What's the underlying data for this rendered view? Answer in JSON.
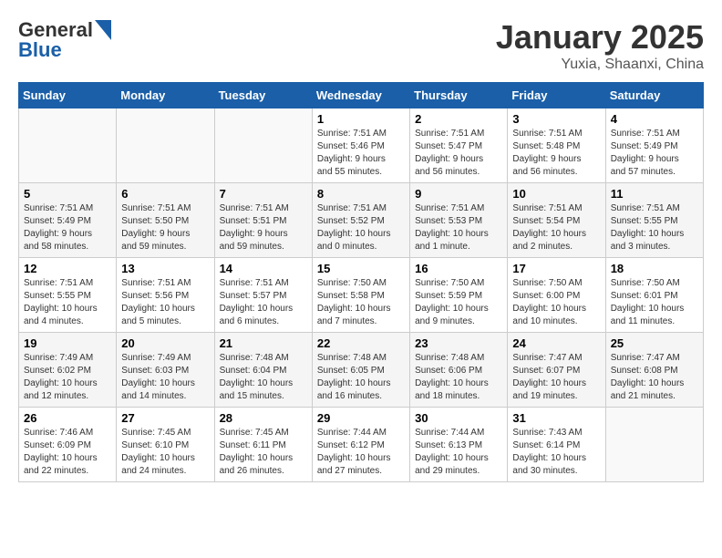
{
  "header": {
    "logo_line1": "General",
    "logo_line2": "Blue",
    "month": "January 2025",
    "location": "Yuxia, Shaanxi, China"
  },
  "weekdays": [
    "Sunday",
    "Monday",
    "Tuesday",
    "Wednesday",
    "Thursday",
    "Friday",
    "Saturday"
  ],
  "weeks": [
    [
      {
        "day": "",
        "info": ""
      },
      {
        "day": "",
        "info": ""
      },
      {
        "day": "",
        "info": ""
      },
      {
        "day": "1",
        "info": "Sunrise: 7:51 AM\nSunset: 5:46 PM\nDaylight: 9 hours\nand 55 minutes."
      },
      {
        "day": "2",
        "info": "Sunrise: 7:51 AM\nSunset: 5:47 PM\nDaylight: 9 hours\nand 56 minutes."
      },
      {
        "day": "3",
        "info": "Sunrise: 7:51 AM\nSunset: 5:48 PM\nDaylight: 9 hours\nand 56 minutes."
      },
      {
        "day": "4",
        "info": "Sunrise: 7:51 AM\nSunset: 5:49 PM\nDaylight: 9 hours\nand 57 minutes."
      }
    ],
    [
      {
        "day": "5",
        "info": "Sunrise: 7:51 AM\nSunset: 5:49 PM\nDaylight: 9 hours\nand 58 minutes."
      },
      {
        "day": "6",
        "info": "Sunrise: 7:51 AM\nSunset: 5:50 PM\nDaylight: 9 hours\nand 59 minutes."
      },
      {
        "day": "7",
        "info": "Sunrise: 7:51 AM\nSunset: 5:51 PM\nDaylight: 9 hours\nand 59 minutes."
      },
      {
        "day": "8",
        "info": "Sunrise: 7:51 AM\nSunset: 5:52 PM\nDaylight: 10 hours\nand 0 minutes."
      },
      {
        "day": "9",
        "info": "Sunrise: 7:51 AM\nSunset: 5:53 PM\nDaylight: 10 hours\nand 1 minute."
      },
      {
        "day": "10",
        "info": "Sunrise: 7:51 AM\nSunset: 5:54 PM\nDaylight: 10 hours\nand 2 minutes."
      },
      {
        "day": "11",
        "info": "Sunrise: 7:51 AM\nSunset: 5:55 PM\nDaylight: 10 hours\nand 3 minutes."
      }
    ],
    [
      {
        "day": "12",
        "info": "Sunrise: 7:51 AM\nSunset: 5:55 PM\nDaylight: 10 hours\nand 4 minutes."
      },
      {
        "day": "13",
        "info": "Sunrise: 7:51 AM\nSunset: 5:56 PM\nDaylight: 10 hours\nand 5 minutes."
      },
      {
        "day": "14",
        "info": "Sunrise: 7:51 AM\nSunset: 5:57 PM\nDaylight: 10 hours\nand 6 minutes."
      },
      {
        "day": "15",
        "info": "Sunrise: 7:50 AM\nSunset: 5:58 PM\nDaylight: 10 hours\nand 7 minutes."
      },
      {
        "day": "16",
        "info": "Sunrise: 7:50 AM\nSunset: 5:59 PM\nDaylight: 10 hours\nand 9 minutes."
      },
      {
        "day": "17",
        "info": "Sunrise: 7:50 AM\nSunset: 6:00 PM\nDaylight: 10 hours\nand 10 minutes."
      },
      {
        "day": "18",
        "info": "Sunrise: 7:50 AM\nSunset: 6:01 PM\nDaylight: 10 hours\nand 11 minutes."
      }
    ],
    [
      {
        "day": "19",
        "info": "Sunrise: 7:49 AM\nSunset: 6:02 PM\nDaylight: 10 hours\nand 12 minutes."
      },
      {
        "day": "20",
        "info": "Sunrise: 7:49 AM\nSunset: 6:03 PM\nDaylight: 10 hours\nand 14 minutes."
      },
      {
        "day": "21",
        "info": "Sunrise: 7:48 AM\nSunset: 6:04 PM\nDaylight: 10 hours\nand 15 minutes."
      },
      {
        "day": "22",
        "info": "Sunrise: 7:48 AM\nSunset: 6:05 PM\nDaylight: 10 hours\nand 16 minutes."
      },
      {
        "day": "23",
        "info": "Sunrise: 7:48 AM\nSunset: 6:06 PM\nDaylight: 10 hours\nand 18 minutes."
      },
      {
        "day": "24",
        "info": "Sunrise: 7:47 AM\nSunset: 6:07 PM\nDaylight: 10 hours\nand 19 minutes."
      },
      {
        "day": "25",
        "info": "Sunrise: 7:47 AM\nSunset: 6:08 PM\nDaylight: 10 hours\nand 21 minutes."
      }
    ],
    [
      {
        "day": "26",
        "info": "Sunrise: 7:46 AM\nSunset: 6:09 PM\nDaylight: 10 hours\nand 22 minutes."
      },
      {
        "day": "27",
        "info": "Sunrise: 7:45 AM\nSunset: 6:10 PM\nDaylight: 10 hours\nand 24 minutes."
      },
      {
        "day": "28",
        "info": "Sunrise: 7:45 AM\nSunset: 6:11 PM\nDaylight: 10 hours\nand 26 minutes."
      },
      {
        "day": "29",
        "info": "Sunrise: 7:44 AM\nSunset: 6:12 PM\nDaylight: 10 hours\nand 27 minutes."
      },
      {
        "day": "30",
        "info": "Sunrise: 7:44 AM\nSunset: 6:13 PM\nDaylight: 10 hours\nand 29 minutes."
      },
      {
        "day": "31",
        "info": "Sunrise: 7:43 AM\nSunset: 6:14 PM\nDaylight: 10 hours\nand 30 minutes."
      },
      {
        "day": "",
        "info": ""
      }
    ]
  ]
}
